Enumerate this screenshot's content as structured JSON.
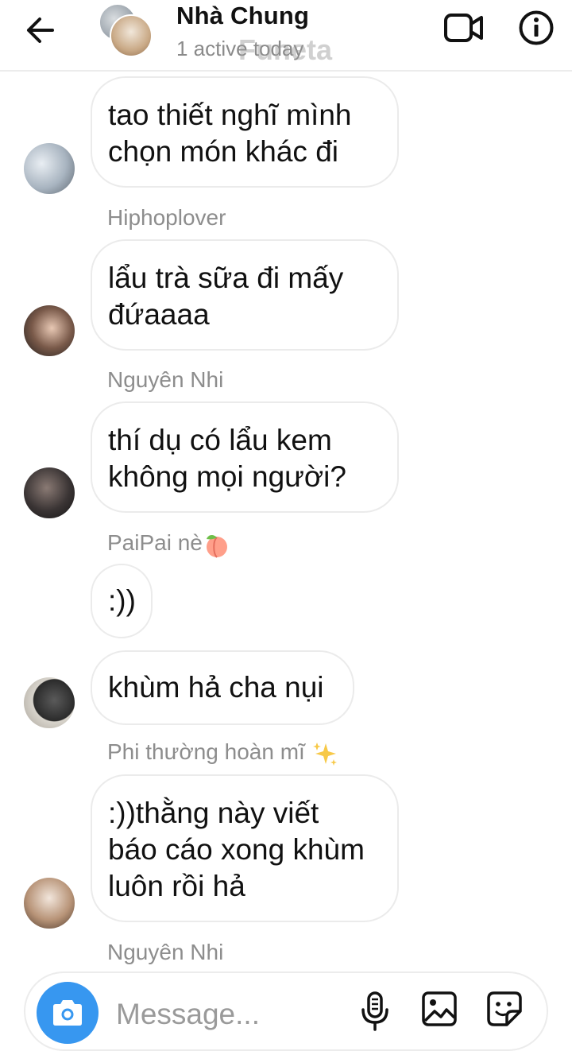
{
  "header": {
    "title": "Nhà Chung",
    "status": "1 active today",
    "watermark": "Funeta"
  },
  "messages": [
    {
      "sender": "",
      "text_lines": [
        "tao thiết nghĩ mình",
        "chọn món khác đi"
      ]
    },
    {
      "sender": "Hiphoplover",
      "text_lines": [
        "lẩu trà sữa đi mấy",
        "đứaaaa"
      ]
    },
    {
      "sender": "Nguyên Nhi",
      "text_lines": [
        "thí dụ có lẩu kem",
        "không mọi người?"
      ]
    },
    {
      "sender": "PaiPai nè",
      "sender_emoji": "peach-emoji",
      "text_lines": [
        ":))"
      ]
    },
    {
      "sender": "",
      "text_lines": [
        "khùm hả cha nụi"
      ]
    },
    {
      "sender": "Phi thường hoàn mĩ",
      "sender_emoji": "sparkles-emoji",
      "text_lines": [
        ":))thằng này viết",
        "báo cáo xong khùm",
        "luôn rồi hả"
      ]
    },
    {
      "sender": "Nguyên Nhi",
      "text_lines": []
    }
  ],
  "composer": {
    "placeholder": "Message...",
    "icons": [
      "camera-icon",
      "microphone-icon",
      "gallery-icon",
      "sticker-icon"
    ]
  },
  "colors": {
    "accent": "#3797f0",
    "sender_text": "#8d8d8d",
    "bubble_border": "#ebebeb"
  }
}
